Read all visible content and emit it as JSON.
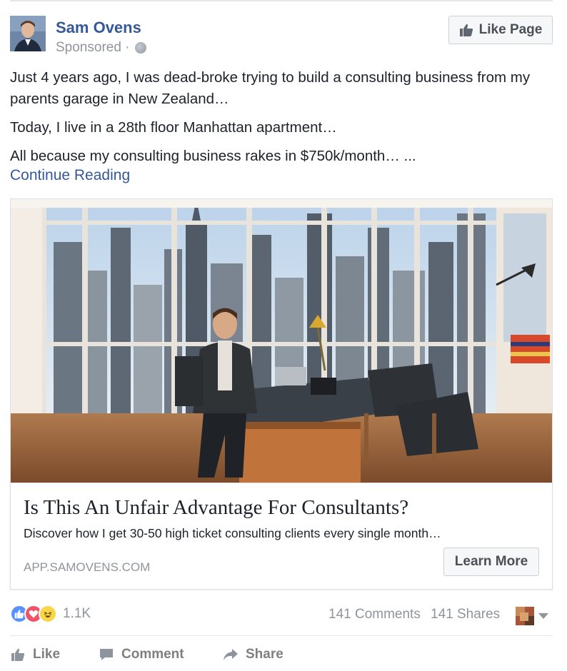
{
  "post": {
    "author": "Sam Ovens",
    "sponsored": "Sponsored ·",
    "like_page_label": "Like Page",
    "paragraphs": [
      "Just 4 years ago, I was dead-broke trying to build a consulting business from my parents garage in New Zealand…",
      "Today, I live in a 28th floor Manhattan apartment…",
      "All because my consulting business rakes in $750k/month… ..."
    ],
    "continue_reading": "Continue Reading"
  },
  "link_card": {
    "headline": "Is This An Unfair Advantage For Consultants?",
    "description": "Discover how I get 30-50 high ticket consulting clients every single month…",
    "domain": "APP.SAMOVENS.COM",
    "cta_label": "Learn More"
  },
  "engagement": {
    "reaction_count": "1.1K",
    "comments": "141 Comments",
    "shares": "141 Shares",
    "reaction_icons": [
      "like-icon",
      "love-icon",
      "haha-icon"
    ]
  },
  "actions": {
    "like": "Like",
    "comment": "Comment",
    "share": "Share"
  },
  "colors": {
    "link_blue": "#365899",
    "meta_gray": "#90949c",
    "like_blue": "#5890ff",
    "love_red": "#f25268",
    "haha_yellow": "#f7d64a"
  }
}
